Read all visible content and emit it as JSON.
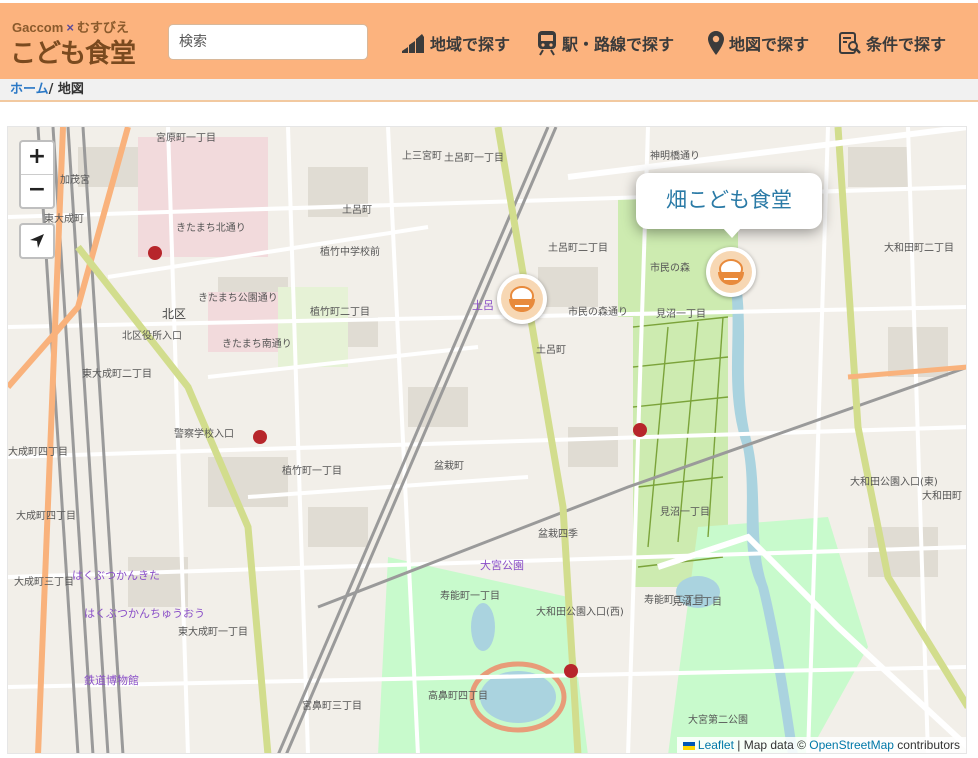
{
  "header": {
    "logo_top_left": "Gaccom",
    "logo_top_x": "×",
    "logo_top_right": "むすびえ",
    "logo_main": "こども食堂",
    "search_placeholder": "検索",
    "nav": [
      {
        "label": "地域で探す",
        "icon": "map-region-icon"
      },
      {
        "label": "駅・路線で探す",
        "icon": "train-icon"
      },
      {
        "label": "地図で探す",
        "icon": "map-pin-icon"
      },
      {
        "label": "条件で探す",
        "icon": "search-filter-icon"
      }
    ],
    "background_color": "#fcb37e"
  },
  "breadcrumb": {
    "home": "ホーム",
    "separator": "/",
    "current": "地図"
  },
  "map": {
    "zoom_in": "+",
    "zoom_out": "−",
    "popup_title": "畑こども食堂",
    "attribution": {
      "leaflet": "Leaflet",
      "sep": " | Map data © ",
      "osm": "OpenStreetMap",
      "contributors": " contributors"
    },
    "labels": [
      "宮原町一丁目",
      "加茂宮",
      "東大成町",
      "北区",
      "北区役所入口",
      "東大成町二丁目",
      "大成町四丁目",
      "大成町四丁目",
      "大成町三丁目",
      "はくぶつかんきた",
      "はくぶつかんちゅうおう",
      "鉄道博物館",
      "東大成町一丁目",
      "上三宮町",
      "きたまち北通り",
      "植竹中学校前",
      "きたまち公園通り",
      "植竹町二丁目",
      "きたまち南通り",
      "警察学校入口",
      "植竹町一丁目",
      "土呂町一丁目",
      "土呂町",
      "土呂",
      "土呂町二丁目",
      "土呂町",
      "盆栽町",
      "盆栽四季",
      "大宮公園",
      "寿能町一丁目",
      "寿能町二丁目",
      "高鼻町四丁目",
      "宮鼻町三丁目",
      "大和田公園入口(西)",
      "市民の森",
      "市民の森通り",
      "見沼一丁目",
      "見沼二丁目",
      "見沼一丁目",
      "大和田町二丁目",
      "大和田公園入口(東)",
      "大宮第二公園",
      "神明橋通り",
      "大和田町"
    ]
  }
}
